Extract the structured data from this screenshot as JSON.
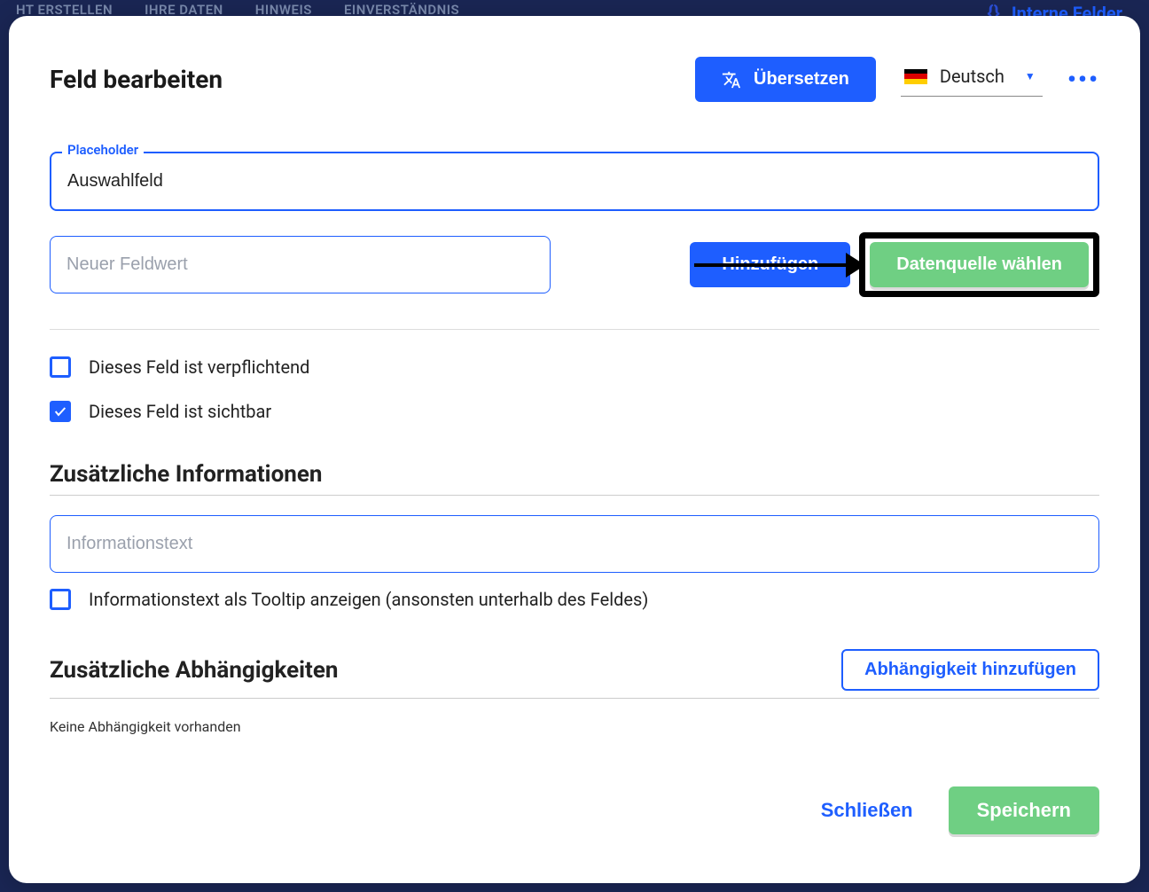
{
  "bg": {
    "tabs": [
      "HT ERSTELLEN",
      "IHRE DATEN",
      "HINWEIS",
      "EINVERSTÄNDNIS"
    ],
    "right_link": "Interne Felder"
  },
  "modal": {
    "title": "Feld bearbeiten",
    "translate_btn": "Übersetzen",
    "language": "Deutsch"
  },
  "placeholder_field": {
    "label": "Placeholder",
    "value": "Auswahlfeld"
  },
  "new_value": {
    "placeholder": "Neuer Feldwert",
    "add_btn": "Hinzufügen",
    "datasource_btn": "Datenquelle wählen"
  },
  "checkboxes": {
    "required": {
      "label": "Dieses Feld ist verpflichtend",
      "checked": false
    },
    "visible": {
      "label": "Dieses Feld ist sichtbar",
      "checked": true
    }
  },
  "sections": {
    "info_title": "Zusätzliche Informationen",
    "info_placeholder": "Informationstext",
    "tooltip_label": "Informationstext als Tooltip anzeigen (ansonsten unterhalb des Feldes)",
    "deps_title": "Zusätzliche Abhängigkeiten",
    "add_dependency_btn": "Abhängigkeit hinzufügen",
    "no_dependency": "Keine Abhängigkeit vorhanden"
  },
  "footer": {
    "close": "Schließen",
    "save": "Speichern"
  }
}
